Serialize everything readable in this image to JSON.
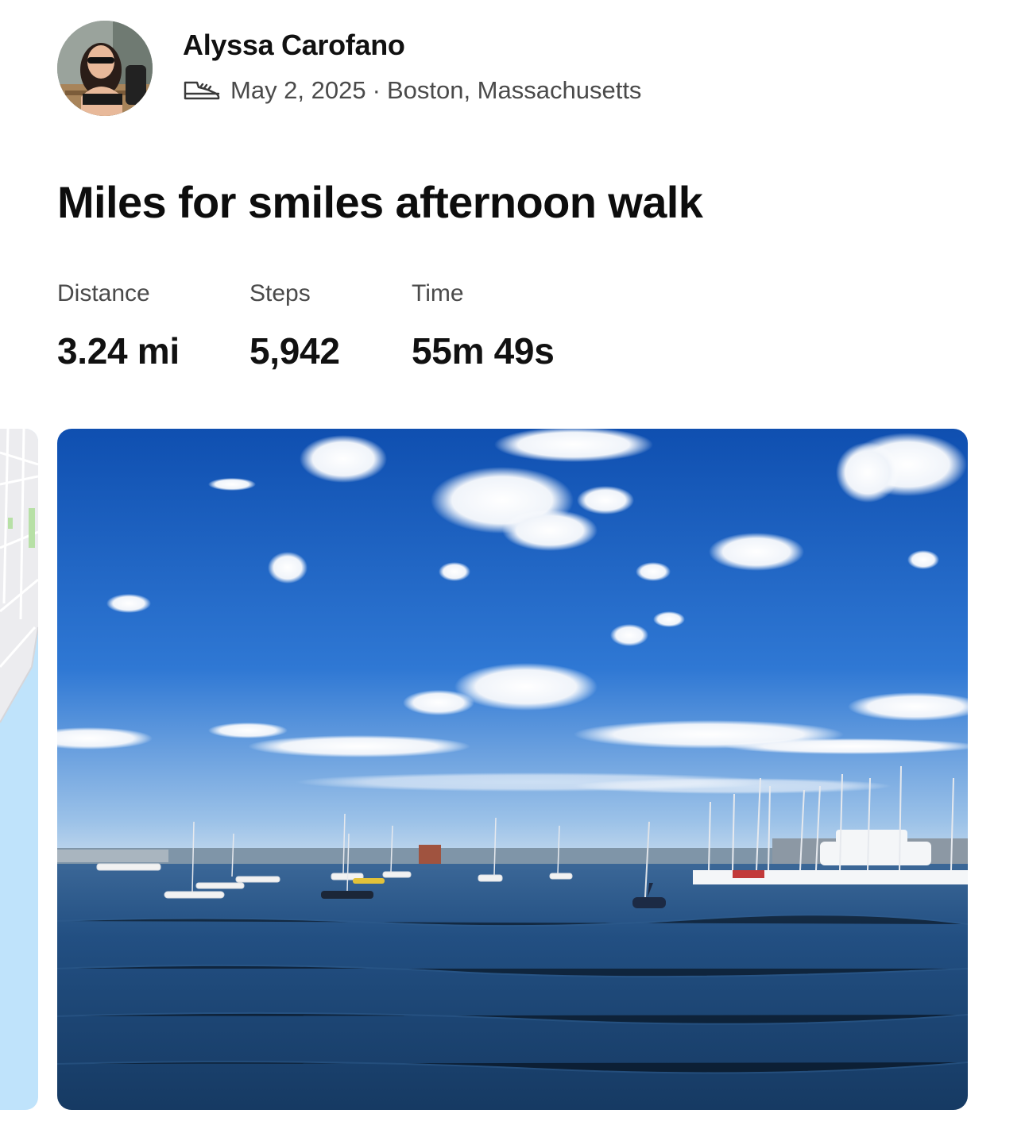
{
  "athlete": {
    "name": "Alyssa Carofano",
    "date": "May 2, 2025",
    "separator": "·",
    "location": "Boston, Massachusetts",
    "activity_icon": "shoe-icon"
  },
  "activity": {
    "title": "Miles for smiles afternoon walk"
  },
  "stats": [
    {
      "label": "Distance",
      "value": "3.24 mi"
    },
    {
      "label": "Steps",
      "value": "5,942"
    },
    {
      "label": "Time",
      "value": "55m 49s"
    }
  ],
  "media": {
    "map": "route-map",
    "photo": "harbor-photo"
  },
  "colors": {
    "text_primary": "#111111",
    "text_secondary": "#4a4a4a",
    "sky": "#1f5fc0",
    "water": "#1e4a7a",
    "map_water": "#bfe3fb"
  }
}
